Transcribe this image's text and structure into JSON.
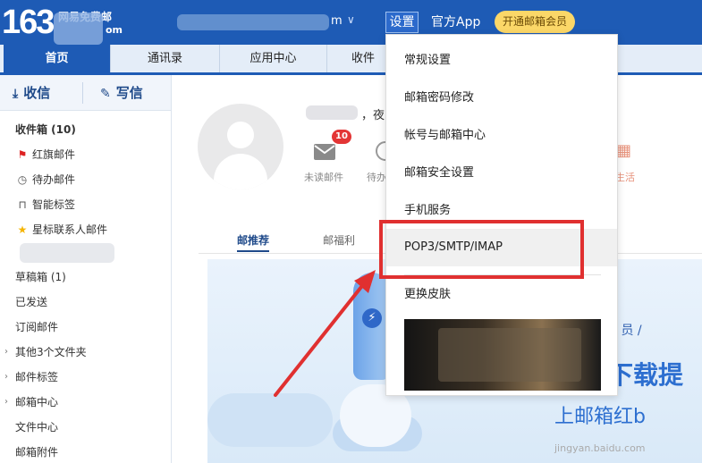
{
  "header": {
    "logo_number": "163",
    "logo_text_line1": "网易免费邮",
    "logo_text_line2": "om",
    "user_suffix": "m",
    "user_chevron": "∨",
    "settings_label": "设置",
    "app_label": "官方App",
    "vip_label": "开通邮箱会员",
    "brand_color": "#1e5bb5"
  },
  "nav": {
    "tabs": [
      {
        "label": "首页",
        "active": true
      },
      {
        "label": "通讯录",
        "active": false
      },
      {
        "label": "应用中心",
        "active": false
      },
      {
        "label": "收件",
        "active": false
      }
    ]
  },
  "sidebar": {
    "receive_label": "收信",
    "write_label": "写信",
    "folders": [
      {
        "label": "收件箱 (10)",
        "icon": ""
      },
      {
        "label": "红旗邮件",
        "icon": "red-flag-icon"
      },
      {
        "label": "待办邮件",
        "icon": "clock-icon"
      },
      {
        "label": "智能标签",
        "icon": "bookmark-icon"
      },
      {
        "label": "星标联系人邮件",
        "icon": "star-icon"
      },
      {
        "label": "草稿箱 (1)",
        "icon": ""
      },
      {
        "label": "已发送",
        "icon": ""
      },
      {
        "label": "订阅邮件",
        "icon": ""
      },
      {
        "label": "其他3个文件夹",
        "icon": "chevron-right-icon"
      },
      {
        "label": "邮件标签",
        "icon": "chevron-right-icon"
      },
      {
        "label": "邮箱中心",
        "icon": "chevron-right-icon"
      },
      {
        "label": "文件中心",
        "icon": ""
      },
      {
        "label": "邮箱附件",
        "icon": ""
      }
    ]
  },
  "main": {
    "greeting_tail": "，夜",
    "unread_count": "10",
    "unread_label": "未读邮件",
    "pending_label": "待办",
    "life_label": "生活",
    "subtabs": [
      "邮推荐",
      "邮福利"
    ],
    "banner": {
      "vip_text": "会 员 /",
      "download_text": "下载提",
      "sub_text": "上邮箱红b",
      "watermark": "jingyan.baidu.com"
    }
  },
  "settings_menu": {
    "items": [
      "常规设置",
      "邮箱密码修改",
      "帐号与邮箱中心",
      "邮箱安全设置",
      "手机服务",
      "POP3/SMTP/IMAP",
      "更换皮肤"
    ],
    "highlighted": "POP3/SMTP/IMAP",
    "highlight_color": "#e03030"
  }
}
